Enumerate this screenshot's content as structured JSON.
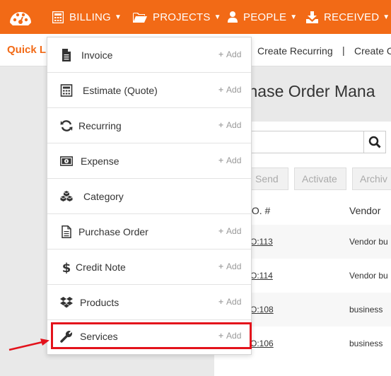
{
  "nav": {
    "items": [
      {
        "label": "BILLING",
        "icon": "calculator-icon"
      },
      {
        "label": "PROJECTS",
        "icon": "folder-icon"
      },
      {
        "label": "PEOPLE",
        "icon": "person-icon"
      },
      {
        "label": "RECEIVED",
        "icon": "download-icon"
      }
    ]
  },
  "quick": {
    "title": "Quick L",
    "links": [
      "Create Recurring",
      "Create C"
    ],
    "separator": "|"
  },
  "page": {
    "title": "chase Order Mana",
    "actions": [
      "Send",
      "Activate",
      "Archiv"
    ],
    "columns": [
      ".O. #",
      "Vendor"
    ],
    "rows": [
      {
        "po": "O:113",
        "vendor": "Vendor bu"
      },
      {
        "po": "O:114",
        "vendor": "Vendor bu"
      },
      {
        "po": "O:108",
        "vendor": "business"
      },
      {
        "po": "O:106",
        "vendor": "business"
      }
    ]
  },
  "menu": {
    "add_label": "Add",
    "items": [
      {
        "label": "Invoice",
        "icon": "file-text-icon",
        "add": true
      },
      {
        "label": "Estimate (Quote)",
        "icon": "calculator-icon",
        "add": true
      },
      {
        "label": "Recurring",
        "icon": "refresh-icon",
        "add": true
      },
      {
        "label": "Expense",
        "icon": "money-icon",
        "add": true
      },
      {
        "label": "Category",
        "icon": "cubes-icon",
        "add": false
      },
      {
        "label": "Purchase Order",
        "icon": "file-icon",
        "add": true
      },
      {
        "label": "Credit Note",
        "icon": "dollar-icon",
        "add": true
      },
      {
        "label": "Products",
        "icon": "dropbox-icon",
        "add": true
      },
      {
        "label": "Services",
        "icon": "wrench-icon",
        "add": true
      }
    ]
  },
  "colors": {
    "brand": "#f26a16",
    "highlight": "#e3121b"
  }
}
